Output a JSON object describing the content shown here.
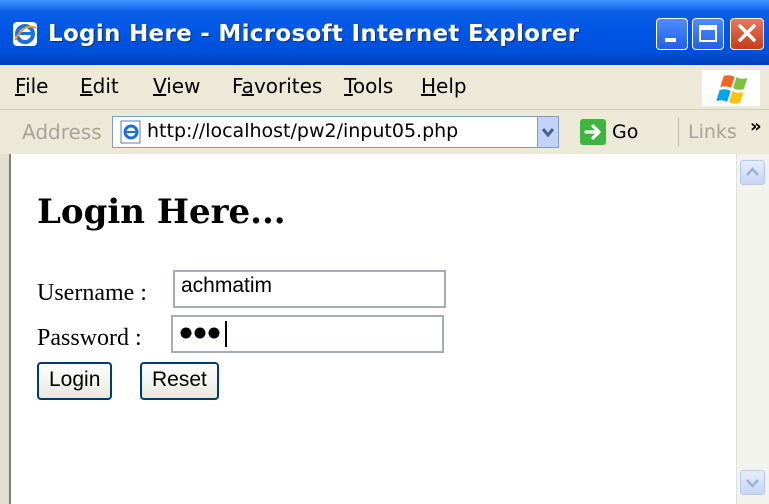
{
  "window": {
    "title": "Login Here - Microsoft Internet Explorer"
  },
  "menubar": {
    "items": [
      {
        "label": "File",
        "access": "F"
      },
      {
        "label": "Edit",
        "access": "E"
      },
      {
        "label": "View",
        "access": "V"
      },
      {
        "label": "Favorites",
        "access": "a"
      },
      {
        "label": "Tools",
        "access": "T"
      },
      {
        "label": "Help",
        "access": "H"
      }
    ]
  },
  "addressbar": {
    "label": "Address",
    "url": "http://localhost/pw2/input05.php",
    "go_label": "Go",
    "links_label": "Links",
    "overflow_glyph": "»"
  },
  "page": {
    "heading": "Login Here...",
    "username_label": "Username :",
    "username_value": "achmatim",
    "password_label": "Password :",
    "password_length": 3,
    "login_button": "Login",
    "reset_button": "Reset"
  },
  "icons": {
    "app": "ie-icon",
    "min": "minimize-icon",
    "max": "maximize-icon",
    "close": "close-icon",
    "go": "go-arrow-icon",
    "logo": "windows-logo-icon",
    "up": "scroll-up-icon",
    "down": "scroll-down-icon"
  },
  "colors": {
    "titlebar": "#0055e5",
    "chrome": "#ece9d8",
    "go": "#3eb53e",
    "close": "#c73b1c"
  }
}
